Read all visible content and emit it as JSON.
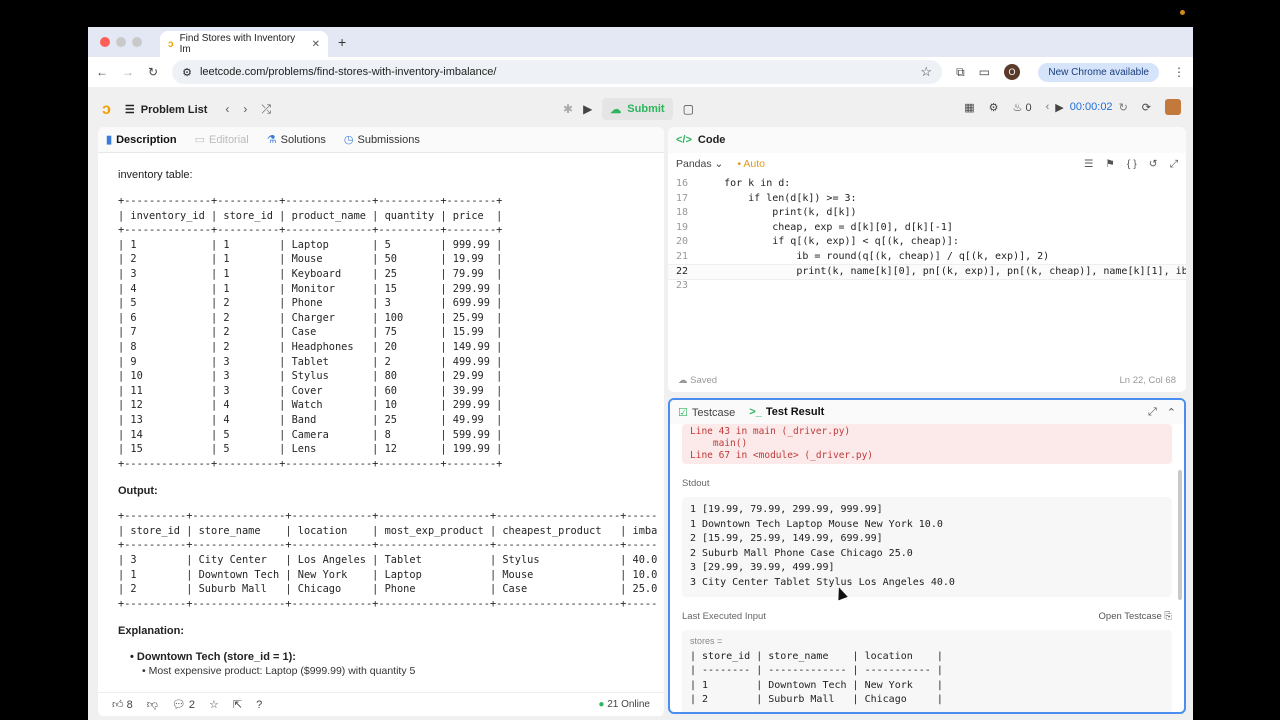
{
  "browser": {
    "tab_title": "Find Stores with Inventory Im",
    "url": "leetcode.com/problems/find-stores-with-inventory-imbalance/",
    "new_chrome": "New Chrome available",
    "profile_initial": "O"
  },
  "nav": {
    "problem_list": "Problem List",
    "submit": "Submit",
    "points": "0",
    "timer": "00:00:02"
  },
  "left_tabs": {
    "description": "Description",
    "editorial": "Editorial",
    "solutions": "Solutions",
    "submissions": "Submissions"
  },
  "description": {
    "inventory_label": "inventory table:",
    "inventory_table": "+--------------+----------+--------------+----------+--------+\n| inventory_id | store_id | product_name | quantity | price  |\n+--------------+----------+--------------+----------+--------+\n| 1            | 1        | Laptop       | 5        | 999.99 |\n| 2            | 1        | Mouse        | 50       | 19.99  |\n| 3            | 1        | Keyboard     | 25       | 79.99  |\n| 4            | 1        | Monitor      | 15       | 299.99 |\n| 5            | 2        | Phone        | 3        | 699.99 |\n| 6            | 2        | Charger      | 100      | 25.99  |\n| 7            | 2        | Case         | 75       | 15.99  |\n| 8            | 2        | Headphones   | 20       | 149.99 |\n| 9            | 3        | Tablet       | 2        | 499.99 |\n| 10           | 3        | Stylus       | 80       | 29.99  |\n| 11           | 3        | Cover        | 60       | 39.99  |\n| 12           | 4        | Watch        | 10       | 299.99 |\n| 13           | 4        | Band         | 25       | 49.99  |\n| 14           | 5        | Camera       | 8        | 599.99 |\n| 15           | 5        | Lens         | 12       | 199.99 |\n+--------------+----------+--------------+----------+--------+",
    "output_label": "Output:",
    "output_table": "+----------+---------------+-------------+------------------+--------------------+------------------+\n| store_id | store_name    | location    | most_exp_product | cheapest_product   | imbalance_ratio  |\n+----------+---------------+-------------+------------------+--------------------+------------------+\n| 3        | City Center   | Los Angeles | Tablet           | Stylus             | 40.00            |\n| 1        | Downtown Tech | New York    | Laptop           | Mouse              | 10.00            |\n| 2        | Suburb Mall   | Chicago     | Phone            | Case               | 25.00            |\n+----------+---------------+-------------+------------------+--------------------+------------------+",
    "explanation_label": "Explanation:",
    "bullet1": "Downtown Tech (store_id = 1):",
    "subbullet1": "Most expensive product: Laptop ($999.99) with quantity 5"
  },
  "left_footer": {
    "likes": "8",
    "comments": "2",
    "online": "21 Online"
  },
  "code": {
    "title": "Code",
    "language": "Pandas",
    "auto": "Auto",
    "saved": "Saved",
    "position": "Ln 22, Col 68",
    "lines": [
      {
        "n": "16",
        "indent": "    ",
        "text": "for k in d:"
      },
      {
        "n": "17",
        "indent": "        ",
        "text": "if len(d[k]) >= 3:"
      },
      {
        "n": "18",
        "indent": "            ",
        "text": "print(k, d[k])"
      },
      {
        "n": "19",
        "indent": "            ",
        "text": "cheap, exp = d[k][0], d[k][-1]"
      },
      {
        "n": "20",
        "indent": "            ",
        "text": "if q[(k, exp)] < q[(k, cheap)]:"
      },
      {
        "n": "21",
        "indent": "                ",
        "text": "ib = round(q[(k, cheap)] / q[(k, exp)], 2)"
      },
      {
        "n": "22",
        "indent": "                ",
        "text": "print(k, name[k][0], pn[(k, exp)], pn[(k, cheap)], name[k][1], ib)"
      },
      {
        "n": "23",
        "indent": "",
        "text": ""
      }
    ]
  },
  "test": {
    "testcase_tab": "Testcase",
    "result_tab": "Test Result",
    "error": "Line 43 in main (_driver.py)\n    main()\nLine 67 in <module> (_driver.py)",
    "stdout_label": "Stdout",
    "stdout": "1 [19.99, 79.99, 299.99, 999.99]\n1 Downtown Tech Laptop Mouse New York 10.0\n2 [15.99, 25.99, 149.99, 699.99]\n2 Suburb Mall Phone Case Chicago 25.0\n3 [29.99, 39.99, 499.99]\n3 City Center Tablet Stylus Los Angeles 40.0",
    "last_input_label": "Last Executed Input",
    "open_testcase": "Open Testcase",
    "stores_var": "stores =",
    "stores_table": "| store_id | store_name    | location    |\n| -------- | ------------- | ----------- |\n| 1        | Downtown Tech | New York    |\n| 2        | Suburb Mall   | Chicago     |"
  }
}
